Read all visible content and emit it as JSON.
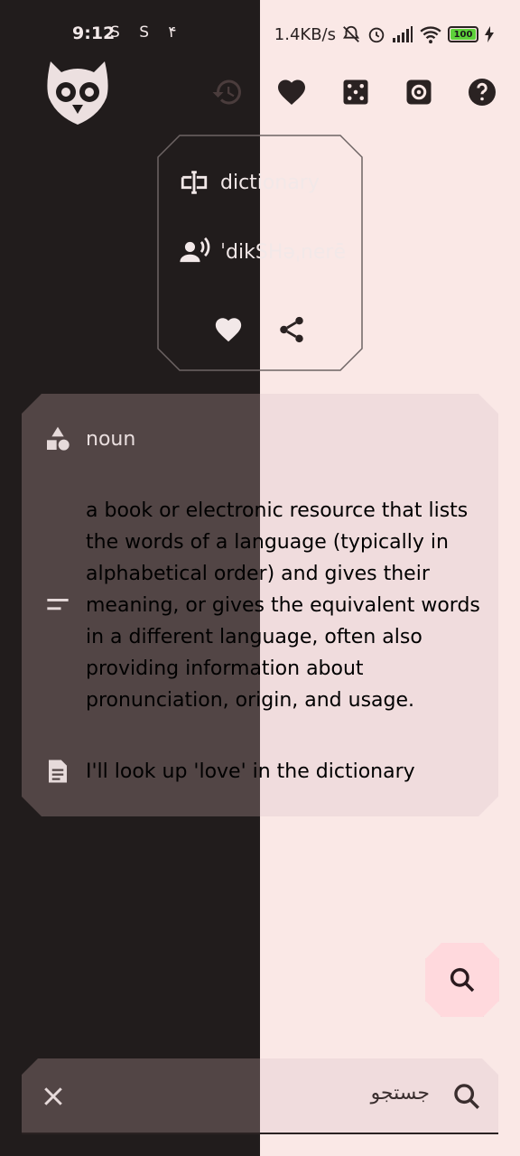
{
  "status_bar": {
    "time": "9:12",
    "left_icons": "S S ۴",
    "speed": "1.4KB/s",
    "battery": "100"
  },
  "word": {
    "text": "dictionary",
    "phonetic": "ˈdikSHəˌnerē"
  },
  "definition": {
    "part_of_speech": "noun",
    "lines": [
      "a book or electronic resource that lists",
      "the words of a language (typically in",
      "alphabetical order) and gives their",
      "meaning, or gives the equivalent words",
      "in a different language, often also",
      "providing information about",
      "pronunciation, origin, and usage."
    ],
    "example": "I'll look up 'love' in the dictionary"
  },
  "search": {
    "value": "جستجو"
  },
  "colors": {
    "left_bg": "#211c1c",
    "right_bg": "#fae8e6",
    "card_left": "#524545",
    "card_right": "#f0dcdd",
    "fab": "#ffd9dd"
  }
}
